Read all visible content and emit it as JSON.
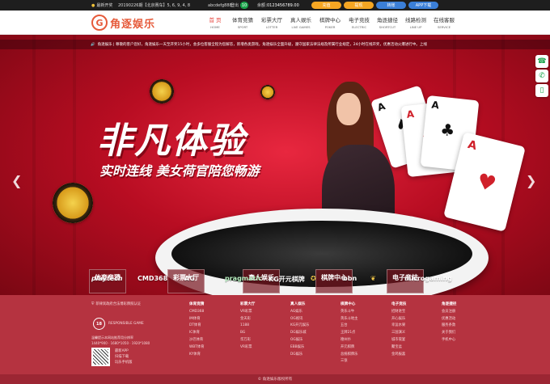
{
  "colors": {
    "brand": "#e65a3a",
    "accent_red": "#e6413a",
    "footer_bg": "#b53340",
    "gold": "#f0c23a",
    "button_orange": "#f5a623",
    "button_blue": "#3b7fd8"
  },
  "topbar": {
    "open": "最新开奖",
    "draw": "20190226期【北京赛车】5, 6, 9, 4, 8",
    "user": "abcdefg888",
    "exit": "登出",
    "msg_count": "10",
    "balance_label": "余额：",
    "balance": "0123456789.00",
    "deposit": "充值",
    "withdraw": "提现",
    "transfer": "转账",
    "app": "APP下载"
  },
  "logo": {
    "mark": "G",
    "text": "角逐娱乐"
  },
  "nav": [
    {
      "cn": "首 页",
      "en": "HOME"
    },
    {
      "cn": "体育竞猜",
      "en": "SPORT"
    },
    {
      "cn": "彩票大厅",
      "en": "LOTTER"
    },
    {
      "cn": "真人娱乐",
      "en": "LIVE GAMES"
    },
    {
      "cn": "棋牌中心",
      "en": "POKER"
    },
    {
      "cn": "电子竞技",
      "en": "ELECTRIC"
    },
    {
      "cn": "角逐捷径",
      "en": "SHORTCUT"
    },
    {
      "cn": "线路检测",
      "en": "LINE UP"
    },
    {
      "cn": "在线客服",
      "en": "SERVICE"
    }
  ],
  "marquee": "角逐娱乐 | 尊敬的客户您好，角逐娱乐一天至开奖15小时，会多位客服全程为您解答，新增各类游戏，角逐娱乐全面升级，遵守国家法律法规及所属行业规定，24小时在线开奖，优惠活动火爆进行中。上线",
  "hero": {
    "title": "非凡体验",
    "subtitle": "实时连线 美女荷官陪您畅游"
  },
  "tiles": [
    "体育竞猜",
    "彩票大厅",
    "真人娱乐",
    "棋牌中心",
    "电子竞技"
  ],
  "partners": [
    "playtech",
    "CMD368",
    "AG",
    "pragmatic",
    "KG开元棋牌",
    "",
    "bbn",
    "",
    "microgaming"
  ],
  "footer": {
    "license": "菲律宾政府合法博彩牌照认证",
    "responsible": "RESPONSIBLE GAME",
    "badge": "18",
    "hint": "温馨提示本网站推荐用分辨率",
    "resolutions": "1440*900 · 1680*1050 · 1920*1080",
    "app": [
      "最新APP",
      "扫描下载",
      "玩乐手机版"
    ],
    "columns": [
      {
        "head": "体育竞猜",
        "items": [
          "CMD368",
          "IM体育",
          "DT体育",
          "IC体育",
          "沙巴体育",
          "WBT体育",
          "KY体育"
        ]
      },
      {
        "head": "彩票大厅",
        "items": [
          "VR彩票",
          "金天彩",
          "1188",
          "BG",
          "华万彩",
          "VR彩票"
        ]
      },
      {
        "head": "真人娱乐",
        "items": [
          "AG娱乐",
          "OG视讯",
          "KG开元娱乐",
          "DG娱乐城",
          "OG娱乐",
          "EBB娱乐",
          "DG娱乐"
        ]
      },
      {
        "head": "棋牌中心",
        "items": [
          "英乐斗牛",
          "英乐斗地主",
          "五台",
          "王牌21点",
          "德州扑",
          "开元棋牌",
          "总统棋牌乐",
          "三张"
        ]
      },
      {
        "head": "电子竞技",
        "items": [
          "招财进宝",
          "开心娱乐",
          "幸运水果",
          "三国演义",
          "城市夜宴",
          "聚宝盆",
          "金鸡报喜"
        ]
      },
      {
        "head": "角逐捷径",
        "items": [
          "会员注册",
          "优惠活动",
          "服务条款",
          "关于我们",
          "手机中心"
        ]
      }
    ],
    "copyright": "© 角逐娱乐版权所有"
  }
}
